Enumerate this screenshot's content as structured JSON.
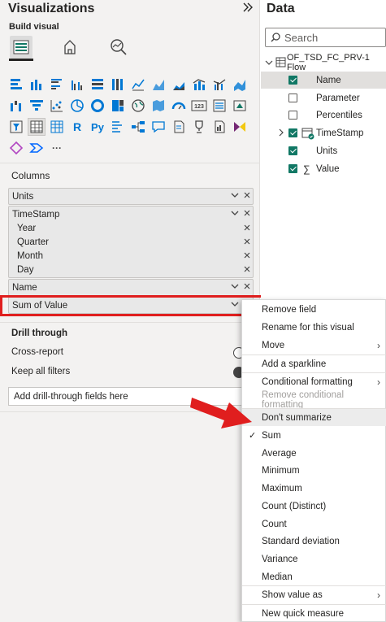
{
  "viz": {
    "title": "Visualizations",
    "build_label": "Build visual",
    "text_visual_r": "R",
    "text_visual_py": "Py",
    "card_icon_text": "123",
    "more_icon_text": "···",
    "columns_label": "Columns",
    "fields": {
      "units": "Units",
      "timestamp": "TimeStamp",
      "year": "Year",
      "quarter": "Quarter",
      "month": "Month",
      "day": "Day",
      "name": "Name",
      "sum_value": "Sum of Value"
    },
    "drill": {
      "title": "Drill through",
      "cross_report": "Cross-report",
      "keep_filters": "Keep all filters",
      "add_fields": "Add drill-through fields here"
    }
  },
  "data_pane": {
    "title": "Data",
    "search_placeholder": "Search",
    "table_name": "OF_TSD_FC_PRV-1 Flow",
    "items": {
      "name": "Name",
      "parameter": "Parameter",
      "percentiles": "Percentiles",
      "timestamp": "TimeStamp",
      "units": "Units",
      "value": "Value"
    }
  },
  "menu": {
    "remove_field": "Remove field",
    "rename": "Rename for this visual",
    "move": "Move",
    "add_sparkline": "Add a sparkline",
    "conditional_formatting": "Conditional formatting",
    "remove_conditional": "Remove conditional formatting",
    "dont_summarize": "Don't summarize",
    "sum": "Sum",
    "average": "Average",
    "minimum": "Minimum",
    "maximum": "Maximum",
    "count_distinct": "Count (Distinct)",
    "count": "Count",
    "std_dev": "Standard deviation",
    "variance": "Variance",
    "median": "Median",
    "show_value_as": "Show value as",
    "new_quick_measure": "New quick measure"
  },
  "colors": {
    "accent_green": "#117865",
    "highlight_red": "#e01e1e",
    "viz_blue": "#0078d4"
  }
}
